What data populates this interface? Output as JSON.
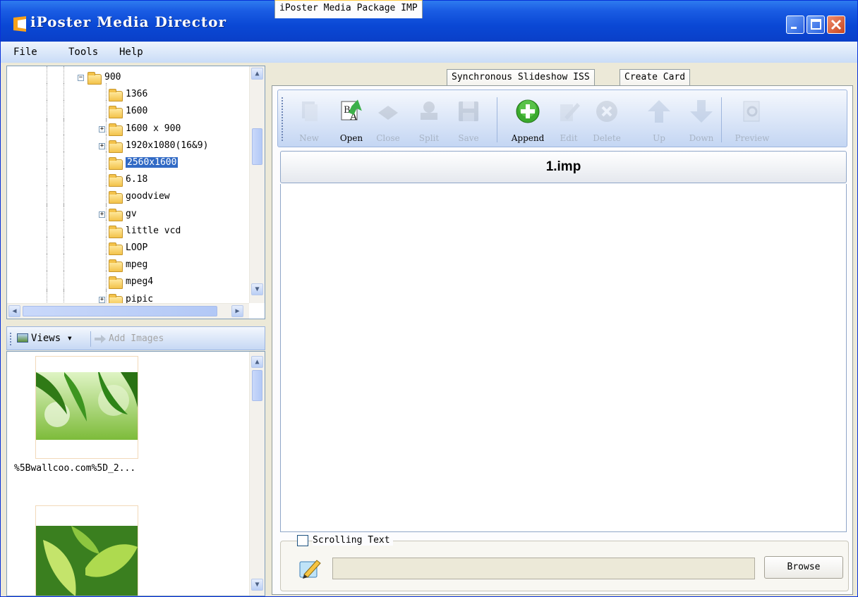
{
  "window": {
    "title": "iPoster Media Director"
  },
  "menu": [
    "File",
    "Tools",
    "Help"
  ],
  "tree": {
    "items": [
      {
        "label": "900",
        "expander": "⊟"
      },
      {
        "label": "1366",
        "expander": ""
      },
      {
        "label": "1600",
        "expander": ""
      },
      {
        "label": "1600 x 900",
        "expander": "⊞"
      },
      {
        "label": "1920x1080(16&9)",
        "expander": "⊞"
      },
      {
        "label": "2560x1600",
        "expander": "",
        "selected": true
      },
      {
        "label": "6.18",
        "expander": ""
      },
      {
        "label": "goodview",
        "expander": ""
      },
      {
        "label": "gv",
        "expander": "⊞"
      },
      {
        "label": "little    vcd",
        "expander": ""
      },
      {
        "label": "LOOP",
        "expander": ""
      },
      {
        "label": "mpeg",
        "expander": ""
      },
      {
        "label": "mpeg4",
        "expander": ""
      },
      {
        "label": "pipic",
        "expander": "⊞"
      }
    ]
  },
  "views_bar": {
    "views_label": "Views",
    "add_images_label": "Add Images"
  },
  "thumbnails": [
    {
      "caption": "%5Bwallcoo.com%5D_2..."
    },
    {
      "caption": ""
    }
  ],
  "tabs": [
    "iPoster Media Package IMP",
    "Synchronous Slideshow ISS",
    "Create Card"
  ],
  "toolbar": {
    "buttons": [
      {
        "label": "New",
        "enabled": false,
        "icon": "new-document-icon"
      },
      {
        "label": "Open",
        "enabled": true,
        "icon": "open-icon"
      },
      {
        "label": "Close",
        "enabled": false,
        "icon": "close-package-icon"
      },
      {
        "label": "Split",
        "enabled": false,
        "icon": "split-icon"
      },
      {
        "label": "Save",
        "enabled": false,
        "icon": "save-icon"
      },
      {
        "label": "Append",
        "enabled": true,
        "icon": "append-icon"
      },
      {
        "label": "Edit",
        "enabled": false,
        "icon": "edit-icon"
      },
      {
        "label": "Delete",
        "enabled": false,
        "icon": "delete-icon"
      },
      {
        "label": "Up",
        "enabled": false,
        "icon": "up-arrow-icon"
      },
      {
        "label": "Down",
        "enabled": false,
        "icon": "down-arrow-icon"
      },
      {
        "label": "Preview",
        "enabled": false,
        "icon": "preview-icon"
      }
    ]
  },
  "file_header": "1.imp",
  "scrolling": {
    "checkbox_label": "Scrolling Text",
    "checked": false,
    "text_value": "",
    "browse_label": "Browse"
  },
  "colors": {
    "title_blue": "#0A48D5",
    "selection": "#316AC5",
    "append_green": "#3BAA2E",
    "tab_accent": "#FFC83C"
  }
}
